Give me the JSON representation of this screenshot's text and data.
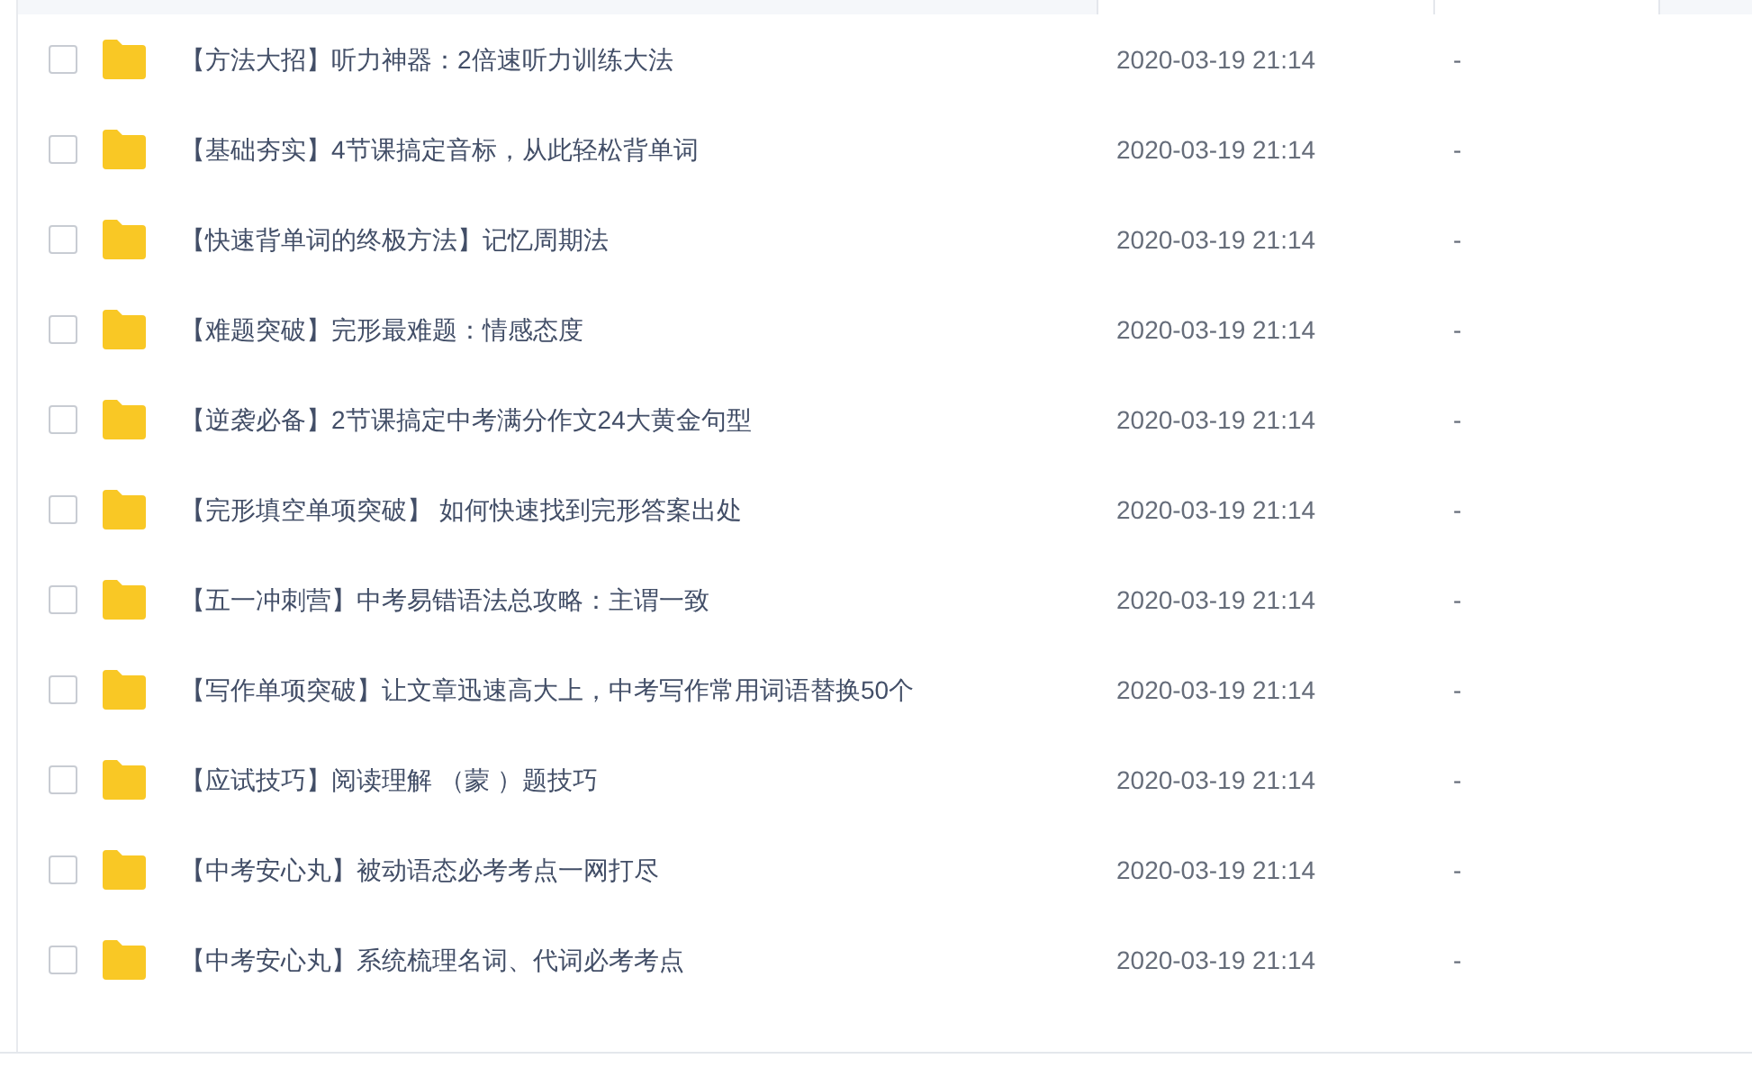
{
  "files": [
    {
      "name": "【方法大招】听力神器：2倍速听力训练大法",
      "modified": "2020-03-19 21:14",
      "size": "-",
      "checked": false
    },
    {
      "name": "【基础夯实】4节课搞定音标，从此轻松背单词",
      "modified": "2020-03-19 21:14",
      "size": "-",
      "checked": false
    },
    {
      "name": "【快速背单词的终极方法】记忆周期法",
      "modified": "2020-03-19 21:14",
      "size": "-",
      "checked": false
    },
    {
      "name": "【难题突破】完形最难题：情感态度",
      "modified": "2020-03-19 21:14",
      "size": "-",
      "checked": false
    },
    {
      "name": "【逆袭必备】2节课搞定中考满分作文24大黄金句型",
      "modified": "2020-03-19 21:14",
      "size": "-",
      "checked": false
    },
    {
      "name": "【完形填空单项突破】 如何快速找到完形答案出处",
      "modified": "2020-03-19 21:14",
      "size": "-",
      "checked": false
    },
    {
      "name": "【五一冲刺营】中考易错语法总攻略：主谓一致",
      "modified": "2020-03-19 21:14",
      "size": "-",
      "checked": false
    },
    {
      "name": "【写作单项突破】让文章迅速高大上，中考写作常用词语替换50个",
      "modified": "2020-03-19 21:14",
      "size": "-",
      "checked": false
    },
    {
      "name": "【应试技巧】阅读理解 （蒙 ）题技巧",
      "modified": "2020-03-19 21:14",
      "size": "-",
      "checked": false
    },
    {
      "name": "【中考安心丸】被动语态必考考点一网打尽",
      "modified": "2020-03-19 21:14",
      "size": "-",
      "checked": false
    },
    {
      "name": "【中考安心丸】系统梳理名词、代词必考考点",
      "modified": "2020-03-19 21:14",
      "size": "-",
      "checked": false
    }
  ]
}
